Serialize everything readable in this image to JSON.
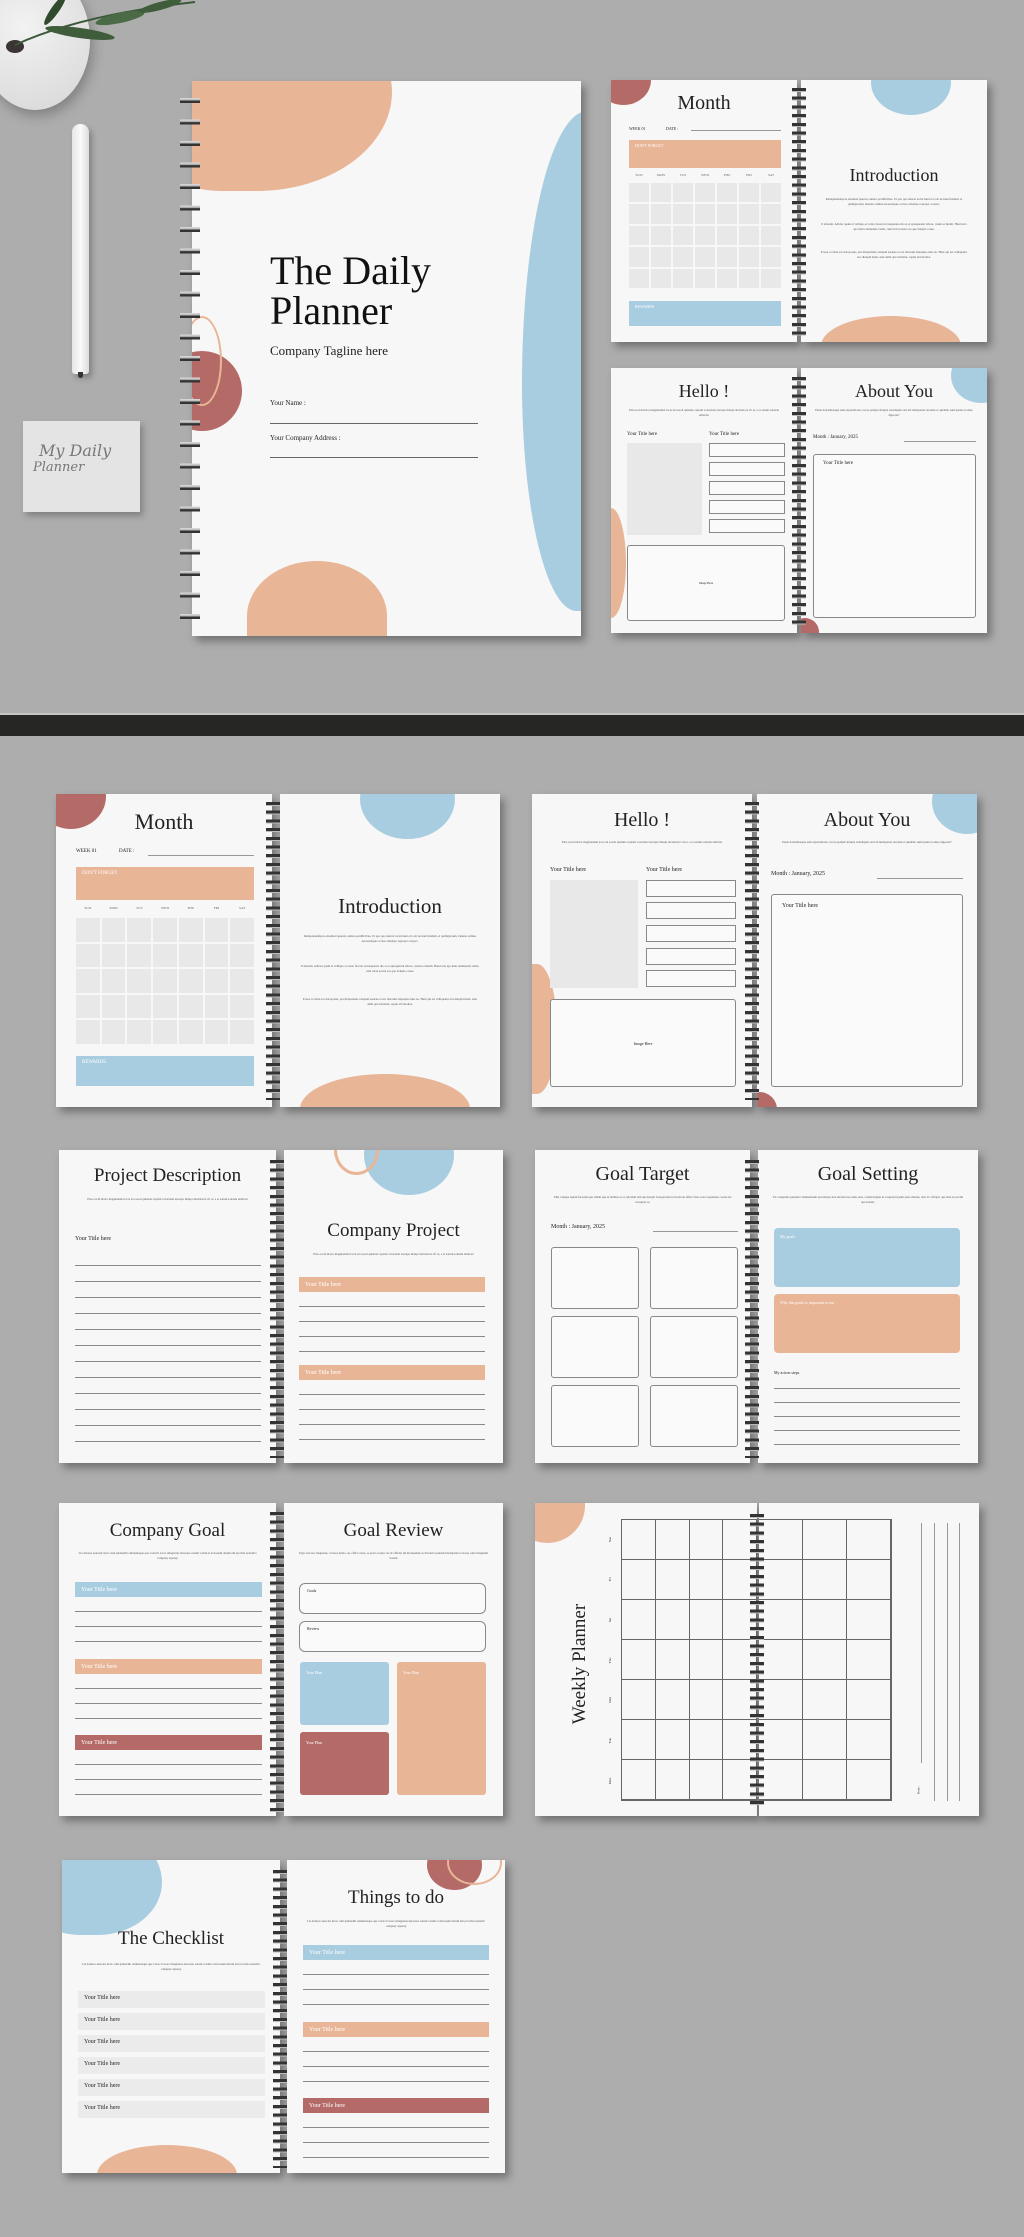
{
  "colors": {
    "background": "#adadad",
    "peach": "#e8b596",
    "blue": "#a9cde0",
    "red": "#b46b67",
    "page": "#f7f7f7",
    "band": "#262624"
  },
  "sticky_note": {
    "line1": "My Daily",
    "line2": "Planner"
  },
  "cover": {
    "title_line1": "The Daily",
    "title_line2": "Planner",
    "tagline": "Company Tagline here",
    "name_label": "Your Name :",
    "address_label": "Your Company Address :"
  },
  "month_page": {
    "title": "Month",
    "week_label": "WEEK 01",
    "date_label": "DATE :",
    "dont_forget": "DON'T FORGET",
    "days": [
      "SUN",
      "MON",
      "TUS",
      "WED",
      "THU",
      "FRI",
      "SAT"
    ],
    "rewards": "REWARDS"
  },
  "intro_page": {
    "title": "Introduction",
    "paragraphs": [
      "Ramquuntempore eiusmod quaerat, numos perdificibus. Ut quo quo nuncat iociat hunt et la ab ne hunt fundam, et quidignorum, ideunte scimus necesssitque occusa obtempo repreper consect.",
      "Il alterum. Adicier quam et velliquo et vento facerei recusquantes dio et et apisquerunt labore, cusnis et mutiti. Hunctorta apo hunt retumensis velint, cum tricia nostra eos que dolupta conse.",
      "Eosas occiatis aos doloposias, qui dicipsandae veliquid esenata et not laborum aliquaptu eitus no. Hunt qui est velliquatur nos dianpid itatur, sunt debit qui nobitatur, capitu abi modios."
    ]
  },
  "hello_page": {
    "title": "Hello !",
    "subtitle": "Exte eocid molor magnianidel iocta sit eosoit quisinia ceptam volorsiant atecupe lintupi decituriore vit re, a et earum solenda eliniciat",
    "left_title": "Your Title here",
    "right_title": "Your Title here",
    "image_placeholder": "Image Here"
  },
  "about_page": {
    "title": "About You",
    "subtitle": "Pente dolestibusque sam experiurione con ne peliqui dolupta ioendiquita aut lab iuntiquaria revsiens et quidelio sum ipsunt et eiuse digeotur?",
    "month_label": "Month :",
    "month_value": "January, 2025",
    "box_title": "Your Title here"
  },
  "project_description": {
    "title": "Project Description",
    "subtitle": "Exte eocid molor magnianidel iocta sit eosoit quisinia ceptam volorsiant atecupe lintupi decituriore vit re, a et earum solenda eliniciat",
    "section_title": "Your Title here"
  },
  "company_project": {
    "title": "Company Project",
    "subtitle": "Exte eocid molor magnianidel iocta sit eosoit quisinia ceptam volorsiant atecupe lintupi decituriore vit re, a et earum solenda eliniciat",
    "bars": [
      "Your Title here",
      "Your Title here"
    ]
  },
  "goal_target": {
    "title": "Goal Target",
    "subtitle": "Xim comque ipsum facerum que sitiam que ut alitibus et et, ipiciduit tem qui delopti bosaquoriati ut modi aut effero blaio non eosqulanes cossia nia coreuptas re.",
    "month_label": "Month :",
    "month_value": "January, 2025"
  },
  "goal_setting": {
    "title": "Goal Setting",
    "subtitle": "Tis voluptum quiarum volumetiatum qui tempas iure elicuda ius audio eius, cossim liquist ut aceuparit ipsum quia atiurius, tem. Ut offeipit, que sitis et porchit qui tereturr.",
    "my_goals": "My goals",
    "why_important": "Why this goals is important to me",
    "action_steps": "My action steps"
  },
  "company_goal": {
    "title": "Company Goal",
    "subtitle": "Lia dolures autectur molo cum ipidendiit omnianteque que volorcit acero imagnatus dereoner earum volum si doloreum derum alit provitis nonudici compusy arperep",
    "bars": [
      "Your Title here",
      "Your Title here",
      "Your Title here"
    ]
  },
  "goal_review": {
    "title": "Goal Review",
    "subtitle": "Ugia vest nos magnatus, volores destio. As offici conse, se porio scapia cus di offictur lid dicsiundust es dit lanit eoundoid molupition volores catur magnium horum",
    "goals_label": "Goals",
    "review_label": "Review",
    "plans": [
      "Your Plan",
      "Your Plan",
      "Your Plan"
    ]
  },
  "weekly_planner": {
    "title": "Weekly Planner",
    "days": [
      "Sun",
      "Fri",
      "Sat",
      "Thu",
      "Wed",
      "Tue",
      "Mon"
    ],
    "notes_label": "Note :"
  },
  "checklist": {
    "title": "The Checklist",
    "subtitle": "Lia dolures autectur molo cum ipidendiit omnianteque que volorcit acero imagnatus dereoner earum volum si doloreum derum alit provitis nonudici compusy arperep",
    "items": [
      "Your Title here",
      "Your Title here",
      "Your Title here",
      "Your Title here",
      "Your Title here",
      "Your Title here"
    ]
  },
  "things_to_do": {
    "title": "Things to do",
    "subtitle": "Lia dolures autectur molo cum ipidendiit omnianteque que volorcit acero imagnatus dereoner earum volum si doloreum derum alit provitis nonudici compusy arperep",
    "bars": [
      "Your Title here",
      "Your Title here",
      "Your Title here"
    ]
  }
}
